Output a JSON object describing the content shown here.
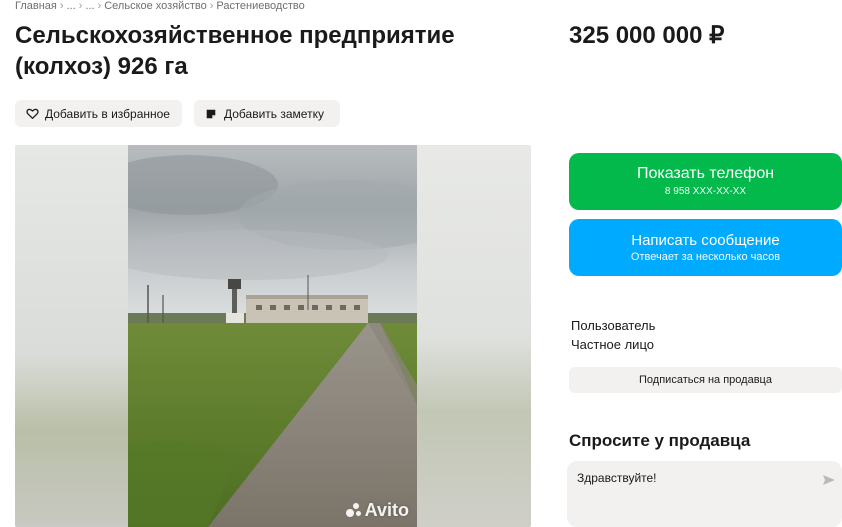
{
  "breadcrumb": [
    "Главная",
    "...",
    "...",
    "Сельское хозяйство",
    "Растениеводство"
  ],
  "listing": {
    "title": "Сельскохозяйственное предприятие (колхоз) 926 га",
    "price": "325 000 000 ₽"
  },
  "actions": {
    "favorite_label": "Добавить в избранное",
    "note_label": "Добавить заметку"
  },
  "gallery": {
    "watermark": "Avito"
  },
  "contact": {
    "phone_label": "Показать телефон",
    "phone_masked": "8 958 XXX-XX-XX",
    "message_label": "Написать сообщение",
    "message_sub": "Отвечает за несколько часов"
  },
  "seller": {
    "name": "Пользователь",
    "type": "Частное лицо",
    "subscribe_label": "Подписаться на продавца"
  },
  "ask": {
    "title": "Спросите у продавца",
    "input_value": "Здравствуйте!"
  },
  "colors": {
    "phone_button": "#04b94b",
    "message_button": "#00aaff",
    "chip_bg": "#f2f1f0"
  },
  "icons": {
    "favorite": "heart-icon",
    "note": "note-icon",
    "send": "send-icon"
  }
}
